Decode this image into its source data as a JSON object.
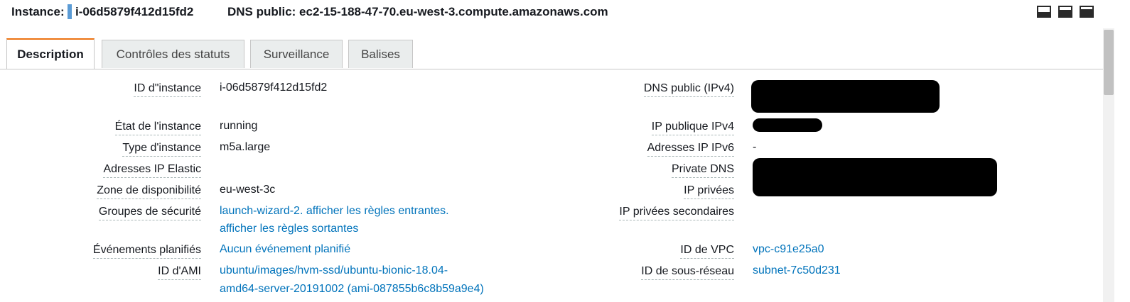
{
  "header": {
    "instance_label": "Instance:",
    "instance_id": "i-06d5879f412d15fd2",
    "dns_public": "DNS public: ec2-15-188-47-70.eu-west-3.compute.amazonaws.com",
    "layout_icons": [
      "panel-bottom-small-icon",
      "panel-bottom-half-icon",
      "panel-bottom-full-icon"
    ]
  },
  "tabs": [
    {
      "label": "Description",
      "active": true
    },
    {
      "label": "Contrôles des statuts",
      "active": false
    },
    {
      "label": "Surveillance",
      "active": false
    },
    {
      "label": "Balises",
      "active": false
    }
  ],
  "left": {
    "instance_id": {
      "label": "ID d\"instance",
      "value": "i-06d5879f412d15fd2"
    },
    "state": {
      "label": "État de l'instance",
      "value": "running"
    },
    "type": {
      "label": "Type d'instance",
      "value": "m5a.large"
    },
    "elastic_ip": {
      "label": "Adresses IP Elastic",
      "value": ""
    },
    "az": {
      "label": "Zone de disponibilité",
      "value": "eu-west-3c"
    },
    "security_groups": {
      "label": "Groupes de sécurité",
      "line1": "launch-wizard-2. afficher les règles entrantes.",
      "line2": "afficher les règles sortantes"
    },
    "events": {
      "label": "Événements planifiés",
      "value": "Aucun événement planifié"
    },
    "ami": {
      "label": "ID d'AMI",
      "line1": "ubuntu/images/hvm-ssd/ubuntu-bionic-18.04-",
      "line2": "amd64-server-20191002 (ami-087855b6c8b59a9e4)"
    }
  },
  "right": {
    "dns_ipv4": {
      "label": "DNS public (IPv4)"
    },
    "ipv4": {
      "label": "IP publique IPv4"
    },
    "ipv6": {
      "label": "Adresses IP IPv6",
      "value": "-"
    },
    "private_dns": {
      "label": "Private DNS"
    },
    "private_ips": {
      "label": "IP privées"
    },
    "secondary_private_ips": {
      "label": "IP privées secondaires"
    },
    "vpc": {
      "label": "ID de VPC",
      "value": "vpc-c91e25a0"
    },
    "subnet": {
      "label": "ID de sous-réseau",
      "value": "subnet-7c50d231"
    }
  },
  "colors": {
    "link": "#0073bb",
    "active_tab_accent": "#ec7211",
    "instance_marker": "#5b9bd5"
  }
}
